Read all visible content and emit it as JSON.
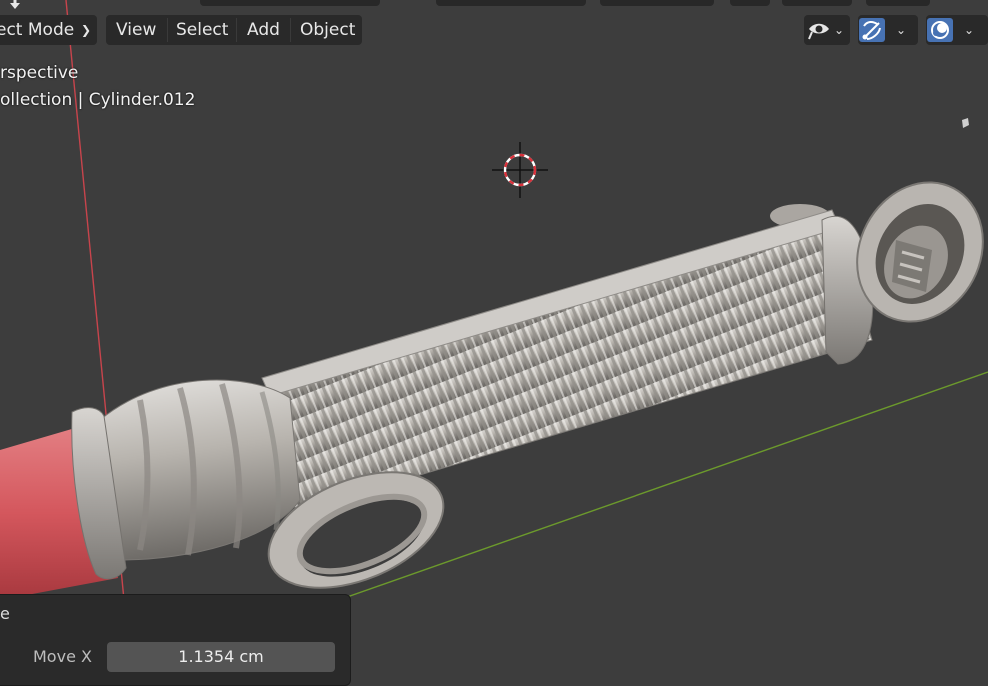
{
  "header": {
    "mode_label": "ect Mode",
    "menus": [
      "View",
      "Select",
      "Add",
      "Object"
    ]
  },
  "viewport": {
    "view_name": "rspective",
    "collection_object": "ollection | Cylinder.012"
  },
  "operator_panel": {
    "title": "e",
    "field_label": "Move X",
    "field_value": "1.1354 cm"
  },
  "icons": {
    "visibility": "eye-icon",
    "gizmo": "gizmo-icon",
    "overlays": "overlays-icon",
    "cursor": "3d-cursor-icon",
    "collapse": "chevron-down-icon"
  },
  "colors": {
    "background": "#3d3d3d",
    "header_button": "#292929",
    "active_toggle": "#4772b3",
    "x_axis": "#c8444c",
    "y_axis": "#6c9a2c"
  }
}
